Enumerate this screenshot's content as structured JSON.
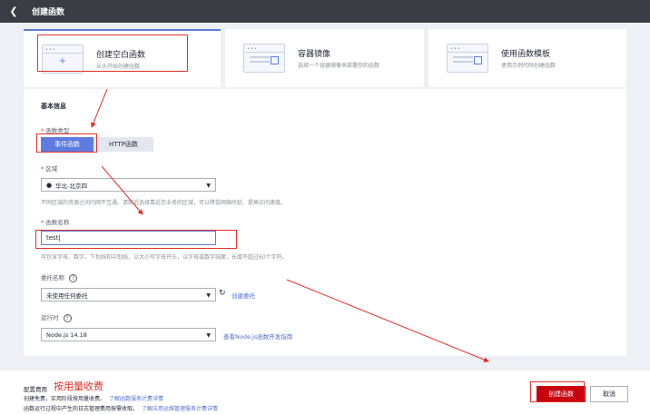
{
  "topbar": {
    "back_icon": "chevron-left-icon",
    "title": "创建函数"
  },
  "cards": [
    {
      "title": "创建空白函数",
      "subtitle": "从头开始创建函数",
      "icon": "blank-function-icon",
      "selected": true
    },
    {
      "title": "容器镜像",
      "subtitle": "选择一个容器镜像来部署你的函数",
      "icon": "container-image-icon",
      "selected": false
    },
    {
      "title": "使用函数模板",
      "subtitle": "使用示例代码创建函数",
      "icon": "template-icon",
      "selected": false
    }
  ],
  "form": {
    "section_title": "基本信息",
    "function_type": {
      "label": "函数类型",
      "options": [
        "事件函数",
        "HTTP函数"
      ],
      "selected": "事件函数"
    },
    "region": {
      "label": "区域",
      "value": "华北-北京四",
      "hint": "不同区域的资源之间内网不互通。请就近选择靠近您业务的区域，可以降低网络时延、提高访问速度。"
    },
    "function_name": {
      "label": "函数名称",
      "value": "test",
      "hint": "可包含字母、数字、下划线和中划线，以大小写字母开头，以字母或数字结尾，长度不超过60个字符。"
    },
    "agency": {
      "label": "委托名称",
      "value": "未使用任何委托",
      "create_link": "创建委托"
    },
    "runtime": {
      "label": "运行时",
      "value": "Node.js 14.18",
      "guide_link": "查看Node.js函数开发指南"
    }
  },
  "footer": {
    "fee_label": "配置费用",
    "fee_value": "按用量收费",
    "line1": "创建免费，实用阶段按用量收费。",
    "line1_link": "了解函数服务计费详情",
    "line2": "函数运行过程中产生的日志管理费用按需收取。",
    "line2_link": "了解应用运维管理服务计费详情",
    "create_button": "创建函数",
    "cancel_button": "取消"
  },
  "colors": {
    "accent": "#5e7ce0",
    "primary_button": "#c7000b",
    "annotation": "#e5312a",
    "topbar": "#3a3d44"
  }
}
